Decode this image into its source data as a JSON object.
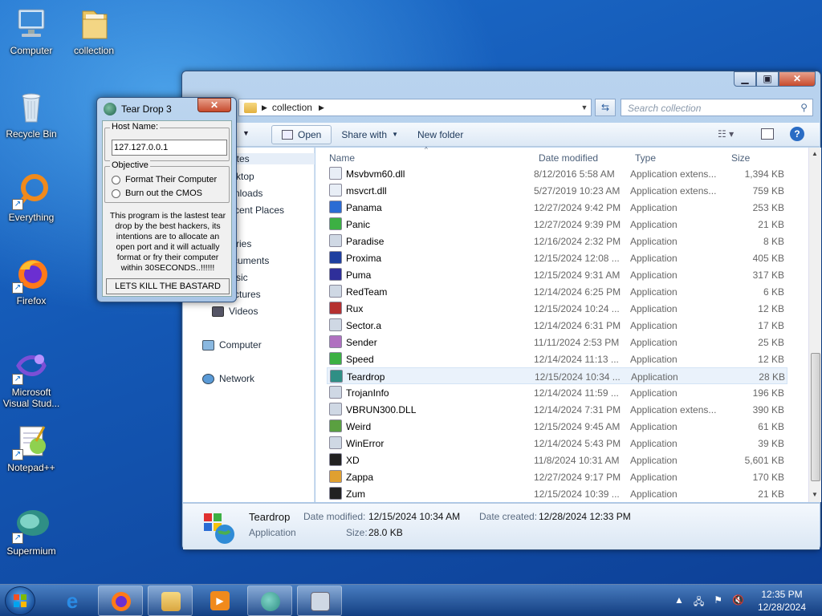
{
  "desktop": {
    "icons": [
      {
        "label": "Computer"
      },
      {
        "label": "collection"
      },
      {
        "label": "Recycle Bin"
      },
      {
        "label": "Everything"
      },
      {
        "label": "Firefox"
      },
      {
        "label": "Microsoft Visual Stud..."
      },
      {
        "label": "Notepad++"
      },
      {
        "label": "Supermium"
      }
    ]
  },
  "explorer": {
    "address": {
      "path": "collection"
    },
    "search_placeholder": "Search collection",
    "toolbar": {
      "open": "Open",
      "share_with": "Share with",
      "new_folder": "New folder"
    },
    "nav": {
      "items": [
        "Favorites",
        "Desktop",
        "Downloads",
        "Recent Places",
        "Libraries",
        "Documents",
        "Music",
        "Pictures",
        "Videos",
        "Computer",
        "Network"
      ],
      "visible": [
        "rites",
        "ktop",
        "nloads",
        "cent Places",
        "ries",
        "cuments",
        "sic",
        "ctures",
        "Videos",
        "Computer",
        "Network"
      ]
    },
    "columns": {
      "name": "Name",
      "date": "Date modified",
      "type": "Type",
      "size": "Size"
    },
    "files": [
      {
        "name": "Msvbvm60.dll",
        "date": "8/12/2016 5:58 AM",
        "type": "Application extens...",
        "size": "1,394 KB"
      },
      {
        "name": "msvcrt.dll",
        "date": "5/27/2019 10:23 AM",
        "type": "Application extens...",
        "size": "759 KB"
      },
      {
        "name": "Panama",
        "date": "12/27/2024 9:42 PM",
        "type": "Application",
        "size": "253 KB"
      },
      {
        "name": "Panic",
        "date": "12/27/2024 9:39 PM",
        "type": "Application",
        "size": "21 KB"
      },
      {
        "name": "Paradise",
        "date": "12/16/2024 2:32 PM",
        "type": "Application",
        "size": "8 KB"
      },
      {
        "name": "Proxima",
        "date": "12/15/2024 12:08 ...",
        "type": "Application",
        "size": "405 KB"
      },
      {
        "name": "Puma",
        "date": "12/15/2024 9:31 AM",
        "type": "Application",
        "size": "317 KB"
      },
      {
        "name": "RedTeam",
        "date": "12/14/2024 6:25 PM",
        "type": "Application",
        "size": "6 KB"
      },
      {
        "name": "Rux",
        "date": "12/15/2024 10:24 ...",
        "type": "Application",
        "size": "12 KB"
      },
      {
        "name": "Sector.a",
        "date": "12/14/2024 6:31 PM",
        "type": "Application",
        "size": "17 KB"
      },
      {
        "name": "Sender",
        "date": "11/11/2024 2:53 PM",
        "type": "Application",
        "size": "25 KB"
      },
      {
        "name": "Speed",
        "date": "12/14/2024 11:13 ...",
        "type": "Application",
        "size": "12 KB"
      },
      {
        "name": "Teardrop",
        "date": "12/15/2024 10:34 ...",
        "type": "Application",
        "size": "28 KB"
      },
      {
        "name": "TrojanInfo",
        "date": "12/14/2024 11:59 ...",
        "type": "Application",
        "size": "196 KB"
      },
      {
        "name": "VBRUN300.DLL",
        "date": "12/14/2024 7:31 PM",
        "type": "Application extens...",
        "size": "390 KB"
      },
      {
        "name": "Weird",
        "date": "12/15/2024 9:45 AM",
        "type": "Application",
        "size": "61 KB"
      },
      {
        "name": "WinError",
        "date": "12/14/2024 5:43 PM",
        "type": "Application",
        "size": "39 KB"
      },
      {
        "name": "XD",
        "date": "11/8/2024 10:31 AM",
        "type": "Application",
        "size": "5,601 KB"
      },
      {
        "name": "Zappa",
        "date": "12/27/2024 9:17 PM",
        "type": "Application",
        "size": "170 KB"
      },
      {
        "name": "Zum",
        "date": "12/15/2024 10:39 ...",
        "type": "Application",
        "size": "21 KB"
      }
    ],
    "selected_index": 12,
    "details": {
      "name": "Teardrop",
      "kind": "Application",
      "modified_label": "Date modified:",
      "modified_value": "12/15/2024 10:34 AM",
      "created_label": "Date created:",
      "created_value": "12/28/2024 12:33 PM",
      "size_label": "Size:",
      "size_value": "28.0 KB"
    }
  },
  "teardrop_dialog": {
    "title": "Tear Drop 3",
    "host_label": "Host Name:",
    "host_value": "127.127.0.0.1",
    "objective_label": "Objective",
    "option1": "Format Their Computer",
    "option2": "Burn out the CMOS",
    "description": "This program is the lastest tear drop by the best hackers, its intentions are to allocate an open port and it will actually format or fry their computer within 30SECONDS..!!!!!!",
    "button": "LETS KILL THE BASTARD"
  },
  "taskbar": {
    "time": "12:35 PM",
    "date": "12/28/2024"
  }
}
